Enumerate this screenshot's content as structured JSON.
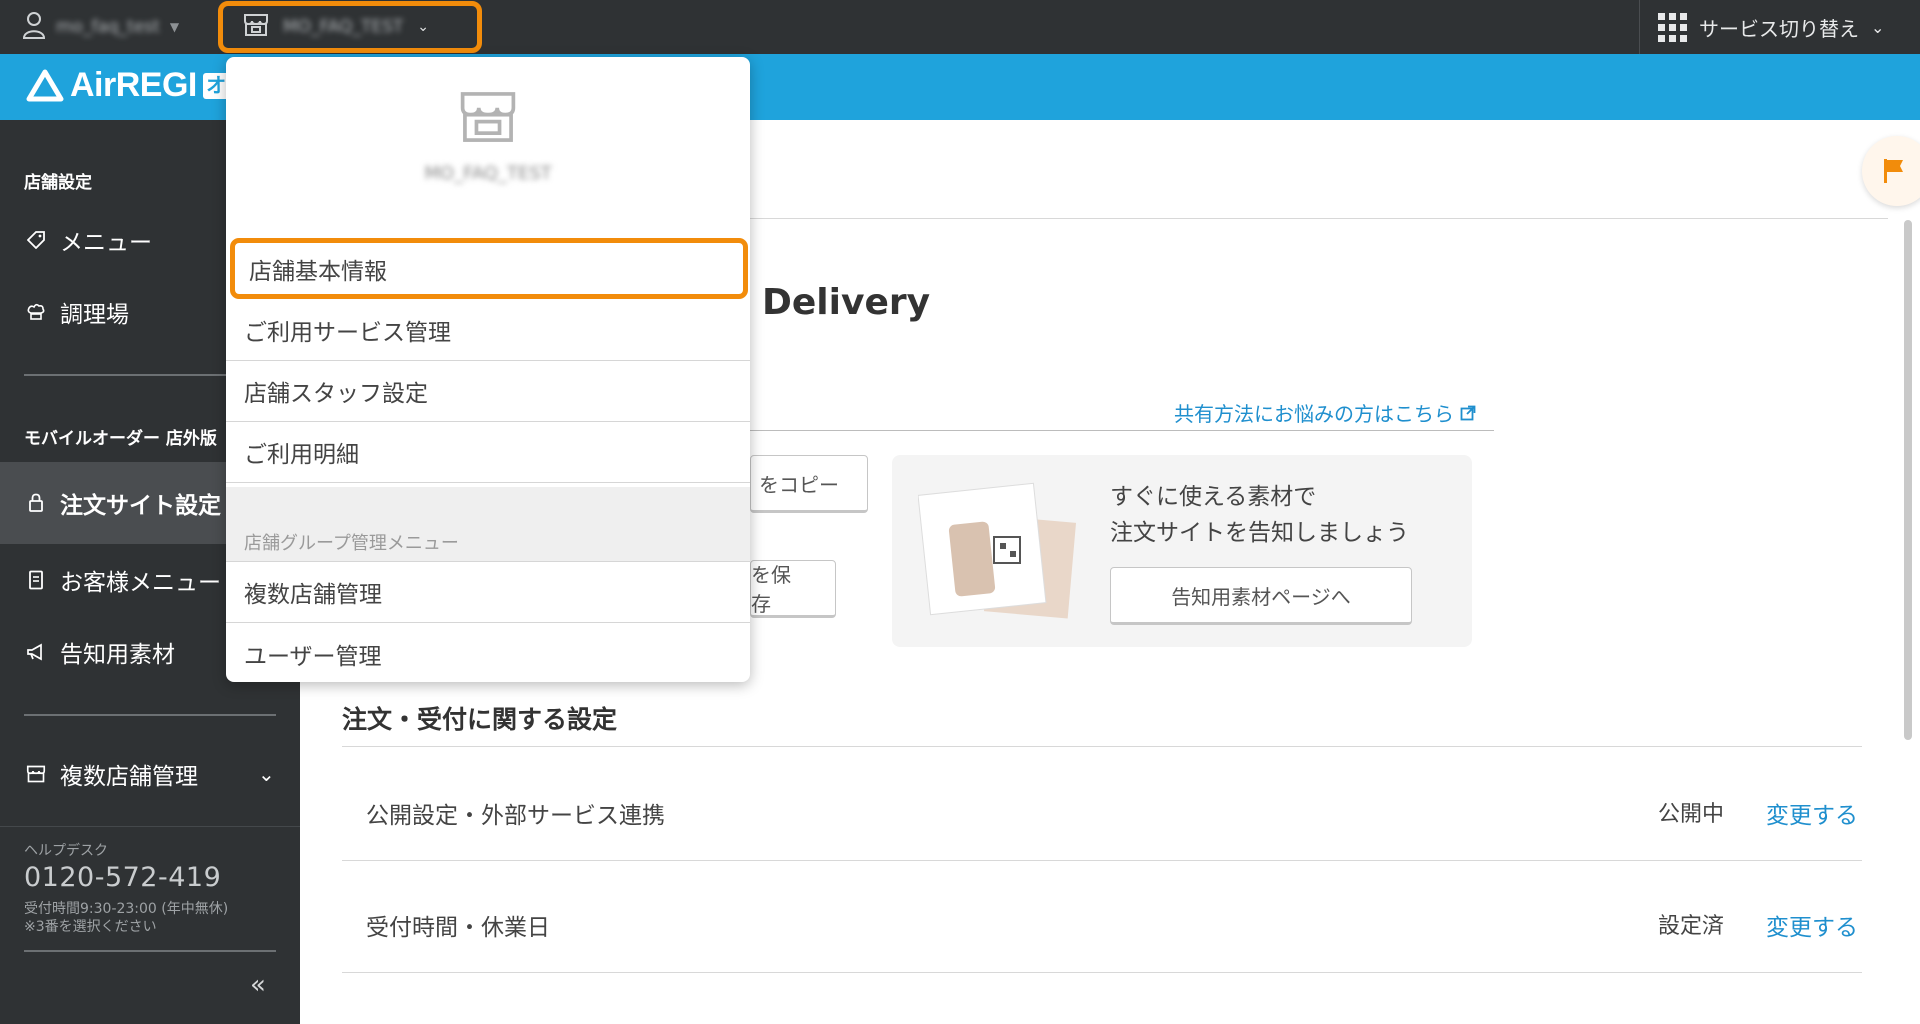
{
  "topbar": {
    "user_name": "mo_faq_test",
    "store_name": "MO_FAQ_TEST",
    "service_switch_label": "サービス切り替え"
  },
  "header": {
    "logo_text": "AirREGI",
    "logo_badge": "オ"
  },
  "sidebar": {
    "section_store": "店舗設定",
    "items_store": [
      {
        "label": "メニュー",
        "icon": "tag-icon"
      },
      {
        "label": "調理場",
        "icon": "chef-hat-icon"
      }
    ],
    "section_mobile": "モバイルオーダー 店外版",
    "items_mobile": [
      {
        "label": "注文サイト設定",
        "icon": "lock-icon"
      },
      {
        "label": "お客様メニュー",
        "icon": "menu-card-icon"
      },
      {
        "label": "告知用素材",
        "icon": "megaphone-icon"
      }
    ],
    "multi_store": "複数店舗管理",
    "help_label": "ヘルプデスク",
    "help_phone": "0120-572-419",
    "help_hours": "受付時間9:30-23:00 (年中無休)",
    "help_note": "※3番を選択ください"
  },
  "main": {
    "title": "Delivery",
    "share_link": "共有方法にお悩みの方はこちら",
    "copy_button": "をコピー",
    "save_button": "を保存",
    "promo_text_1": "すぐに使える素材で",
    "promo_text_2": "注文サイトを告知しましょう",
    "promo_button": "告知用素材ページへ",
    "section_title": "注文・受付に関する設定",
    "settings": [
      {
        "label": "公開設定・外部サービス連携",
        "status": "公開中",
        "link": "変更する"
      },
      {
        "label": "受付時間・休業日",
        "status": "設定済",
        "link": "変更する"
      }
    ]
  },
  "dropdown": {
    "store_name": "MO_FAQ_TEST",
    "items": [
      "店舗基本情報",
      "ご利用サービス管理",
      "店舗スタッフ設定",
      "ご利用明細"
    ],
    "group_label": "店舗グループ管理メニュー",
    "group_items": [
      "複数店舗管理",
      "ユーザー管理"
    ]
  },
  "colors": {
    "topbar": "#2f3234",
    "brand_blue": "#1fa3dc",
    "highlight_orange": "#f28c0b",
    "link_blue": "#1f8fce"
  }
}
